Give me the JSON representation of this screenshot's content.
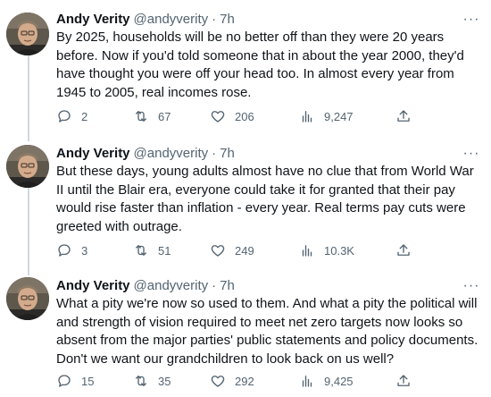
{
  "tweets": [
    {
      "name": "Andy Verity",
      "handle": "@andyverity",
      "separator": "·",
      "time": "7h",
      "text": "By 2025, households will be no better off than they were 20 years before. Now if you'd told someone that in about the year 2000, they'd have thought you were off your head too. In almost every year from 1945 to 2005, real incomes rose.",
      "replies": "2",
      "retweets": "67",
      "likes": "206",
      "views": "9,247",
      "more": "···"
    },
    {
      "name": "Andy Verity",
      "handle": "@andyverity",
      "separator": "·",
      "time": "7h",
      "text": "But these days, young adults almost have no clue that from World War II until the Blair era, everyone could take it for granted that their pay would rise faster than inflation - every year. Real terms pay cuts were greeted with outrage.",
      "replies": "3",
      "retweets": "51",
      "likes": "249",
      "views": "10.3K",
      "more": "···"
    },
    {
      "name": "Andy Verity",
      "handle": "@andyverity",
      "separator": "·",
      "time": "7h",
      "text": "What a pity we're now so used to them. And what a pity the political will and strength of vision required to meet net zero targets now looks so absent from the major parties' public statements and policy documents. Don't we want our grandchildren to look back on us well?",
      "replies": "15",
      "retweets": "35",
      "likes": "292",
      "views": "9,425",
      "more": "···"
    }
  ],
  "icons": {
    "reply": "reply-icon",
    "retweet": "retweet-icon",
    "like": "heart-icon",
    "views": "views-icon",
    "share": "share-icon",
    "more": "more-icon"
  },
  "colors": {
    "text": "#0f1419",
    "secondary": "#536471",
    "thread_line": "#cfd9de",
    "background": "#ffffff"
  }
}
